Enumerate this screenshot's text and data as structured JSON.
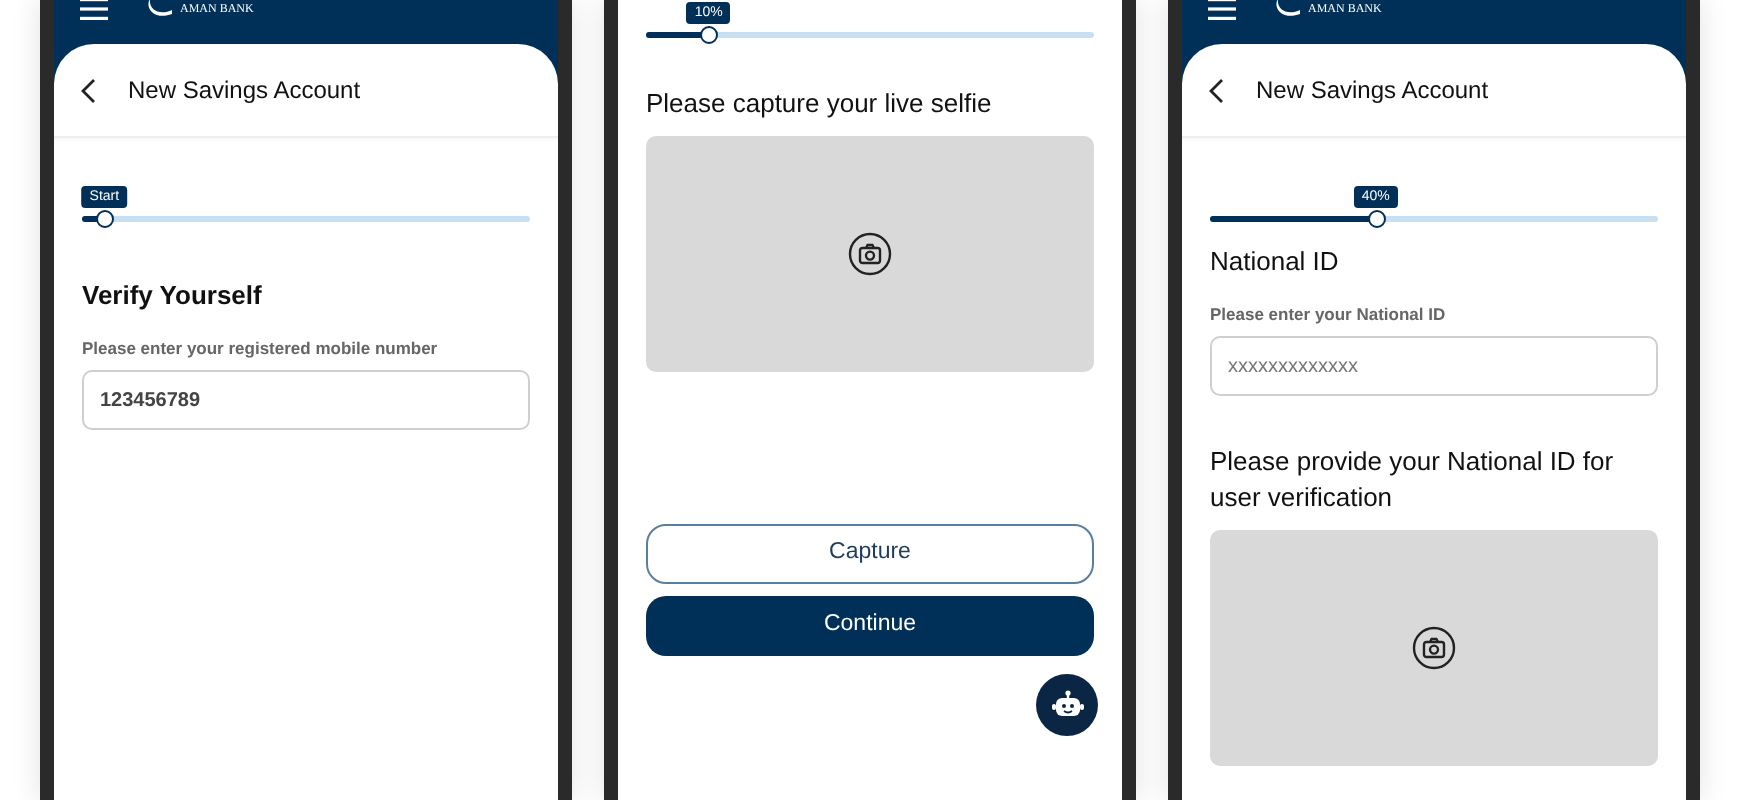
{
  "phones": [
    {
      "header": {
        "logo_text": "AMAN BANK"
      },
      "title": "New Savings Account",
      "progress": {
        "label": "Start",
        "level": 0.05
      },
      "sections": [
        {
          "kind": "heading",
          "text": "Verify Yourself"
        },
        {
          "kind": "field",
          "label": "Please enter your registered mobile number",
          "value": "123456789"
        }
      ]
    },
    {
      "progress": {
        "label": "10%",
        "level": 0.14
      },
      "chat_button": true,
      "sections": [
        {
          "kind": "prompt",
          "text": "Please capture your live selfie"
        },
        {
          "kind": "photo_slot"
        },
        {
          "kind": "buttons",
          "items": [
            {
              "label": "Capture",
              "kind": "outline"
            },
            {
              "label": "Continue",
              "kind": "primary"
            }
          ]
        }
      ]
    },
    {
      "header": {
        "logo_text": "AMAN BANK"
      },
      "title": "New Savings Account",
      "progress": {
        "label": "40%",
        "level": 0.37
      },
      "sections": [
        {
          "kind": "title",
          "text": "National ID"
        },
        {
          "kind": "field",
          "label": "Please enter your National ID",
          "placeholder": "xxxxxxxxxxxxx"
        },
        {
          "kind": "prompt",
          "text": "Please provide your National ID for user verification"
        },
        {
          "kind": "photo_slot"
        }
      ]
    }
  ]
}
